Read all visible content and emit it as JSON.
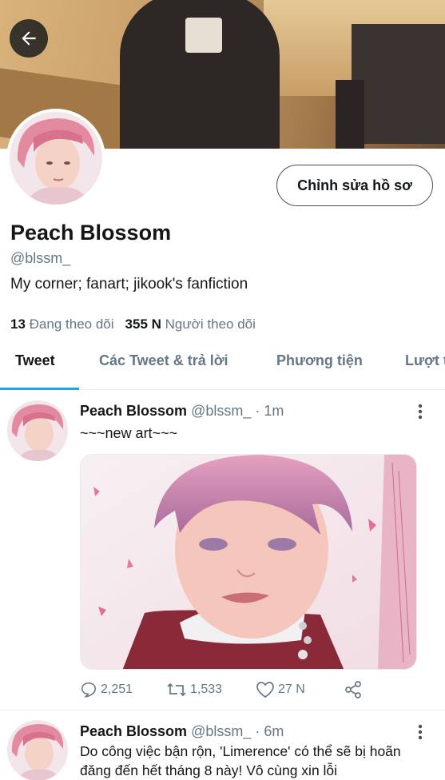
{
  "header": {
    "back_icon": "arrow-left-icon",
    "edit_profile_label": "Chỉnh sửa hồ sơ"
  },
  "profile": {
    "name": "Peach Blossom",
    "handle": "@blssm_",
    "bio": "My corner; fanart; jikook's fanfiction",
    "following_count": "13",
    "following_label": "Đang theo dõi",
    "followers_count": "355 N",
    "followers_label": "Người theo dõi"
  },
  "tabs": [
    {
      "label": "Tweet",
      "active": true
    },
    {
      "label": "Các Tweet & trả lời",
      "active": false
    },
    {
      "label": "Phương tiện",
      "active": false
    },
    {
      "label": "Lượt thích",
      "active": false
    }
  ],
  "tweets": [
    {
      "name": "Peach Blossom",
      "handle_time": "@blssm_ · 1m",
      "text": "~~~new art~~~",
      "has_media": true,
      "replies": "2,251",
      "retweets": "1,533",
      "likes": "27 N"
    },
    {
      "name": "Peach Blossom",
      "handle_time": "@blssm_ · 6m",
      "text": "Do công việc bận rộn, 'Limerence' có thể sẽ bị hoãn đăng đến hết tháng 8 này! Vô cùng xin lỗi"
    }
  ],
  "colors": {
    "accent": "#1da1f2",
    "secondary_text": "#657786",
    "primary_text": "#14171a"
  }
}
